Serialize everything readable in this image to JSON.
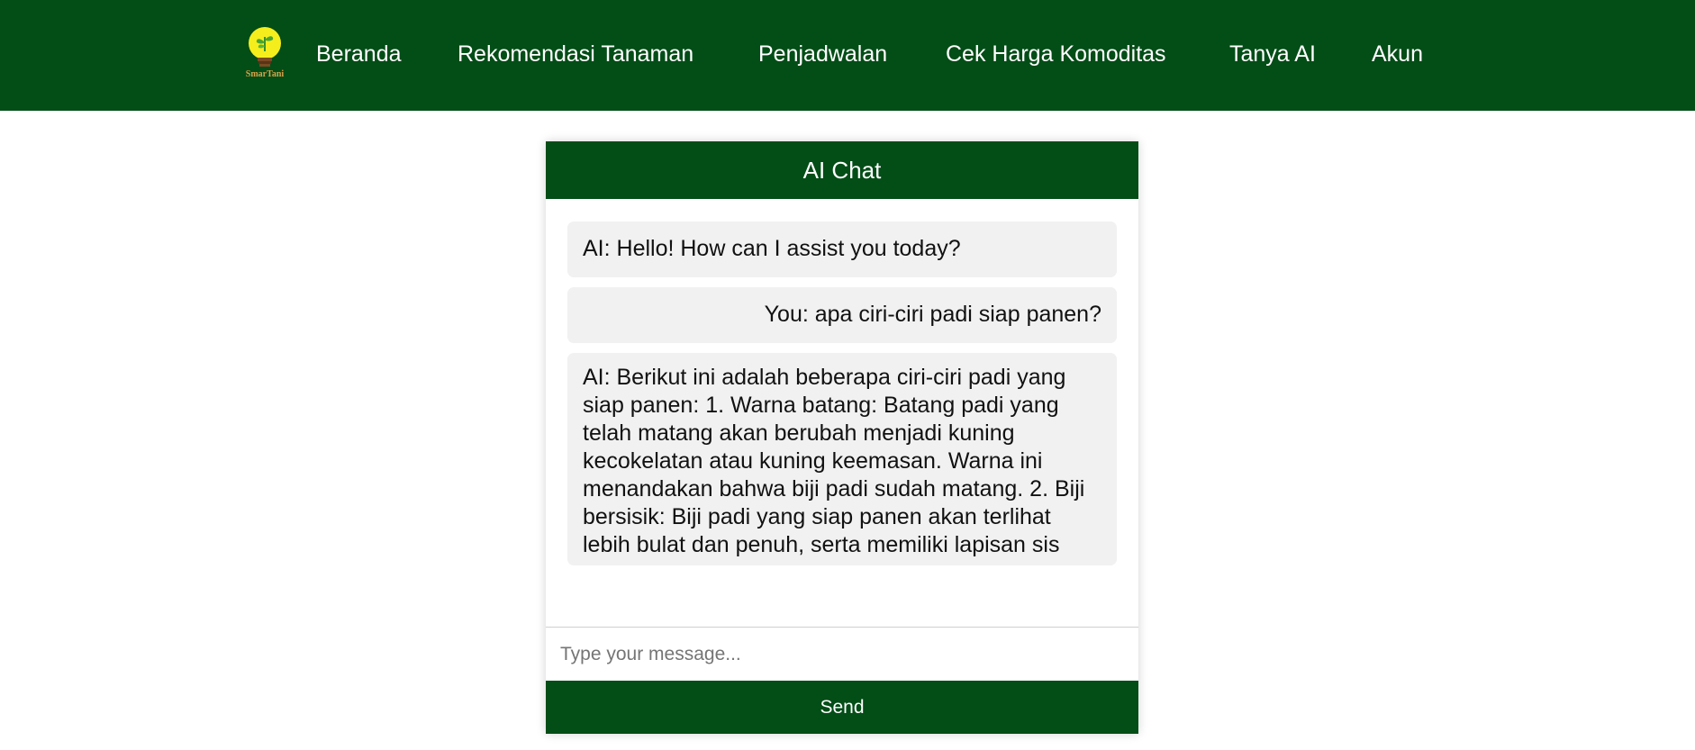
{
  "brand": {
    "logo_text": "SmarTani",
    "accent": "#034d17",
    "bulb_color": "#f5ee1c"
  },
  "nav": {
    "items": [
      {
        "label": "Beranda"
      },
      {
        "label": "Rekomendasi Tanaman"
      },
      {
        "label": "Penjadwalan"
      },
      {
        "label": "Cek Harga Komoditas"
      },
      {
        "label": "Tanya AI"
      },
      {
        "label": "Akun"
      }
    ]
  },
  "chat": {
    "title": "AI Chat",
    "messages": [
      {
        "sender": "ai",
        "text": "AI: Hello! How can I assist you today?"
      },
      {
        "sender": "user",
        "text": "You: apa ciri-ciri padi siap panen?"
      },
      {
        "sender": "ai",
        "text": "AI: Berikut ini adalah beberapa ciri-ciri padi yang siap panen: 1. Warna batang: Batang padi yang telah matang akan berubah menjadi kuning kecokelatan atau kuning keemasan. Warna ini menandakan bahwa biji padi sudah matang. 2. Biji bersisik: Biji padi yang siap panen akan terlihat lebih bulat dan penuh, serta memiliki lapisan sis"
      }
    ],
    "input": {
      "value": "",
      "placeholder": "Type your message..."
    },
    "send_label": "Send"
  }
}
